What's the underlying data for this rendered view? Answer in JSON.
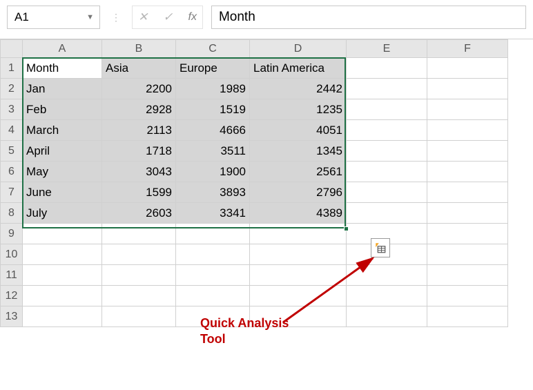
{
  "formula_bar": {
    "name_box_value": "A1",
    "cancel_glyph": "✕",
    "enter_glyph": "✓",
    "fx_label": "fx",
    "cell_content": "Month"
  },
  "columns": [
    "A",
    "B",
    "C",
    "D",
    "E",
    "F"
  ],
  "row_numbers": [
    1,
    2,
    3,
    4,
    5,
    6,
    7,
    8,
    9,
    10,
    11,
    12,
    13
  ],
  "table": {
    "headers": [
      "Month",
      "Asia",
      "Europe",
      "Latin America"
    ],
    "rows": [
      [
        "Jan",
        2200,
        1989,
        2442
      ],
      [
        "Feb",
        2928,
        1519,
        1235
      ],
      [
        "March",
        2113,
        4666,
        4051
      ],
      [
        "April",
        1718,
        3511,
        1345
      ],
      [
        "May",
        3043,
        1900,
        2561
      ],
      [
        "June",
        1599,
        3893,
        2796
      ],
      [
        "July",
        2603,
        3341,
        4389
      ]
    ]
  },
  "annotation": {
    "line1": "Quick Analysis",
    "line2": "Tool"
  }
}
